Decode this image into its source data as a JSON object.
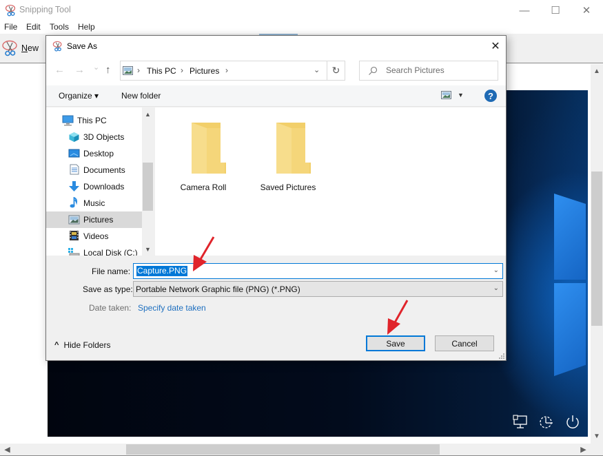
{
  "app": {
    "title": "Snipping Tool",
    "icon": "snipping-tool-scissors-icon",
    "window_controls": {
      "minimize": "—",
      "maximize": "☐",
      "close": "✕"
    },
    "menu": [
      "File",
      "Edit",
      "Tools",
      "Help"
    ],
    "toolbar": {
      "new_label": "New",
      "new_mnemonic": "N",
      "new_rest": "ew"
    }
  },
  "dialog": {
    "title": "Save As",
    "close_glyph": "✕",
    "nav": {
      "back": "←",
      "forward": "→",
      "recent": "⌄",
      "up": "↑",
      "refresh": "↻"
    },
    "breadcrumb": [
      "This PC",
      "Pictures"
    ],
    "breadcrumb_sep": "›",
    "dropdown_glyph": "⌄",
    "search_placeholder": "Search Pictures",
    "commands": {
      "organize": "Organize ▾",
      "new_folder": "New folder",
      "help": "?"
    },
    "tree": [
      {
        "label": "This PC",
        "icon": "computer-icon",
        "level": 0,
        "selected": false
      },
      {
        "label": "3D Objects",
        "icon": "3d-objects-icon",
        "level": 1,
        "selected": false
      },
      {
        "label": "Desktop",
        "icon": "desktop-icon",
        "level": 1,
        "selected": false
      },
      {
        "label": "Documents",
        "icon": "documents-icon",
        "level": 1,
        "selected": false
      },
      {
        "label": "Downloads",
        "icon": "downloads-icon",
        "level": 1,
        "selected": false
      },
      {
        "label": "Music",
        "icon": "music-icon",
        "level": 1,
        "selected": false
      },
      {
        "label": "Pictures",
        "icon": "pictures-icon",
        "level": 1,
        "selected": true
      },
      {
        "label": "Videos",
        "icon": "videos-icon",
        "level": 1,
        "selected": false
      },
      {
        "label": "Local Disk (C:)",
        "icon": "local-disk-icon",
        "level": 1,
        "selected": false
      }
    ],
    "files": [
      {
        "label": "Camera Roll",
        "icon": "folder-icon"
      },
      {
        "label": "Saved Pictures",
        "icon": "folder-icon"
      }
    ],
    "form": {
      "file_name_label": "File name:",
      "file_name_value": "Capture.PNG",
      "save_type_label": "Save as type:",
      "save_type_value": "Portable Network Graphic file (PNG) (*.PNG)",
      "date_taken_label": "Date taken:",
      "date_taken_link": "Specify date taken"
    },
    "hide_folders": "Hide Folders",
    "hide_folders_glyph": "^",
    "save": "Save",
    "cancel": "Cancel"
  },
  "colors": {
    "accent": "#0078d7",
    "annotation_arrow": "#e0242b",
    "link": "#1e6fbf",
    "help": "#1f6ab4"
  }
}
